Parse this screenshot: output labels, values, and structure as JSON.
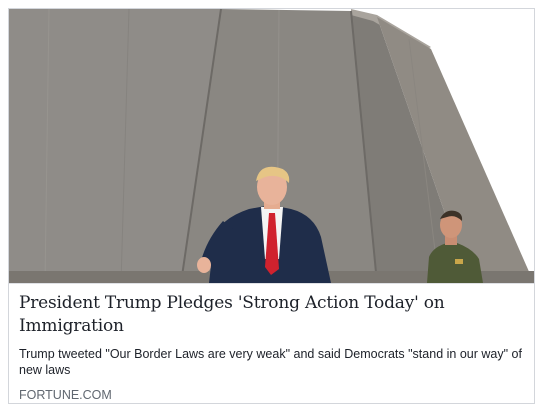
{
  "link_preview": {
    "image": {
      "icon": "photo-icon",
      "subject": "border-wall-photo"
    },
    "headline": "President Trump Pledges 'Strong Action Today' on Immigration",
    "description": "Trump tweeted \"Our Border Laws are very weak\" and said Democrats \"stand in our way\" of new laws",
    "domain": "FORTUNE.COM"
  },
  "colors": {
    "sky": "#ffffff",
    "wall": "#8e8b87",
    "wall_shade": "#7b7873",
    "suit": "#1f2d4a",
    "tie": "#d0222e",
    "uniform": "#4f5a37",
    "headline_text": "#1d2129",
    "domain_text": "#606770",
    "border": "#d3d6db"
  }
}
